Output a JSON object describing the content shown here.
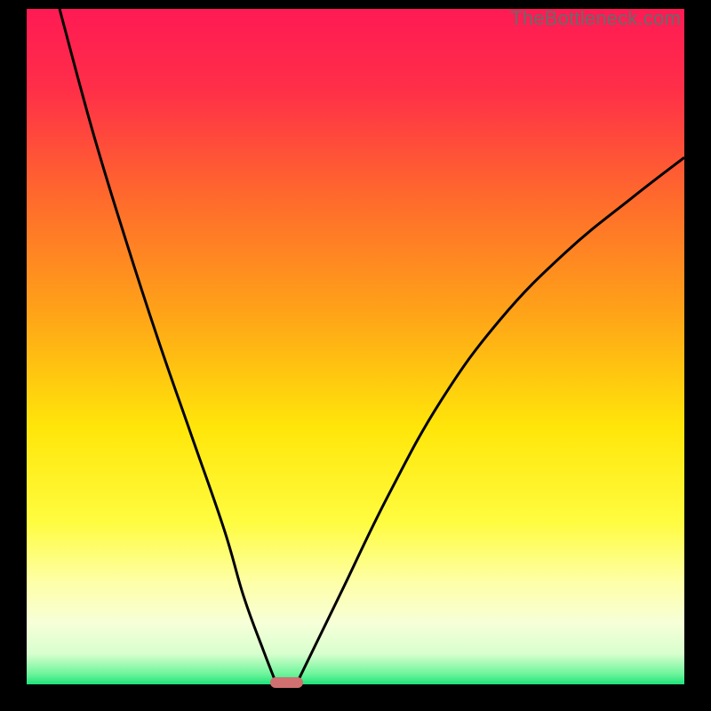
{
  "watermark": "TheBottleneck.com",
  "colors": {
    "black": "#000000",
    "gradient_stops": [
      {
        "offset": 0.0,
        "color": "#ff1a54"
      },
      {
        "offset": 0.12,
        "color": "#ff2f48"
      },
      {
        "offset": 0.28,
        "color": "#ff6a2c"
      },
      {
        "offset": 0.45,
        "color": "#ffa318"
      },
      {
        "offset": 0.62,
        "color": "#ffe609"
      },
      {
        "offset": 0.76,
        "color": "#fffc40"
      },
      {
        "offset": 0.85,
        "color": "#feffa8"
      },
      {
        "offset": 0.91,
        "color": "#f6ffd8"
      },
      {
        "offset": 0.955,
        "color": "#d8ffce"
      },
      {
        "offset": 0.985,
        "color": "#6cf49a"
      },
      {
        "offset": 1.0,
        "color": "#1ee27a"
      }
    ],
    "curve_stroke": "#000000",
    "marker_fill": "#d07070"
  },
  "chart_data": {
    "type": "line",
    "title": "",
    "xlabel": "",
    "ylabel": "",
    "xlim": [
      0,
      100
    ],
    "ylim": [
      0,
      100
    ],
    "series": [
      {
        "name": "left-curve",
        "x": [
          5,
          10,
          15,
          20,
          25,
          30,
          33,
          36,
          38
        ],
        "y": [
          100,
          82,
          66,
          51,
          37,
          23,
          13,
          5,
          0
        ]
      },
      {
        "name": "right-curve",
        "x": [
          41,
          44,
          48,
          55,
          63,
          72,
          82,
          92,
          100
        ],
        "y": [
          0,
          6,
          14,
          28,
          42,
          54,
          64,
          72,
          78
        ]
      }
    ],
    "marker": {
      "x_start": 37,
      "x_end": 42,
      "y": 0
    }
  }
}
